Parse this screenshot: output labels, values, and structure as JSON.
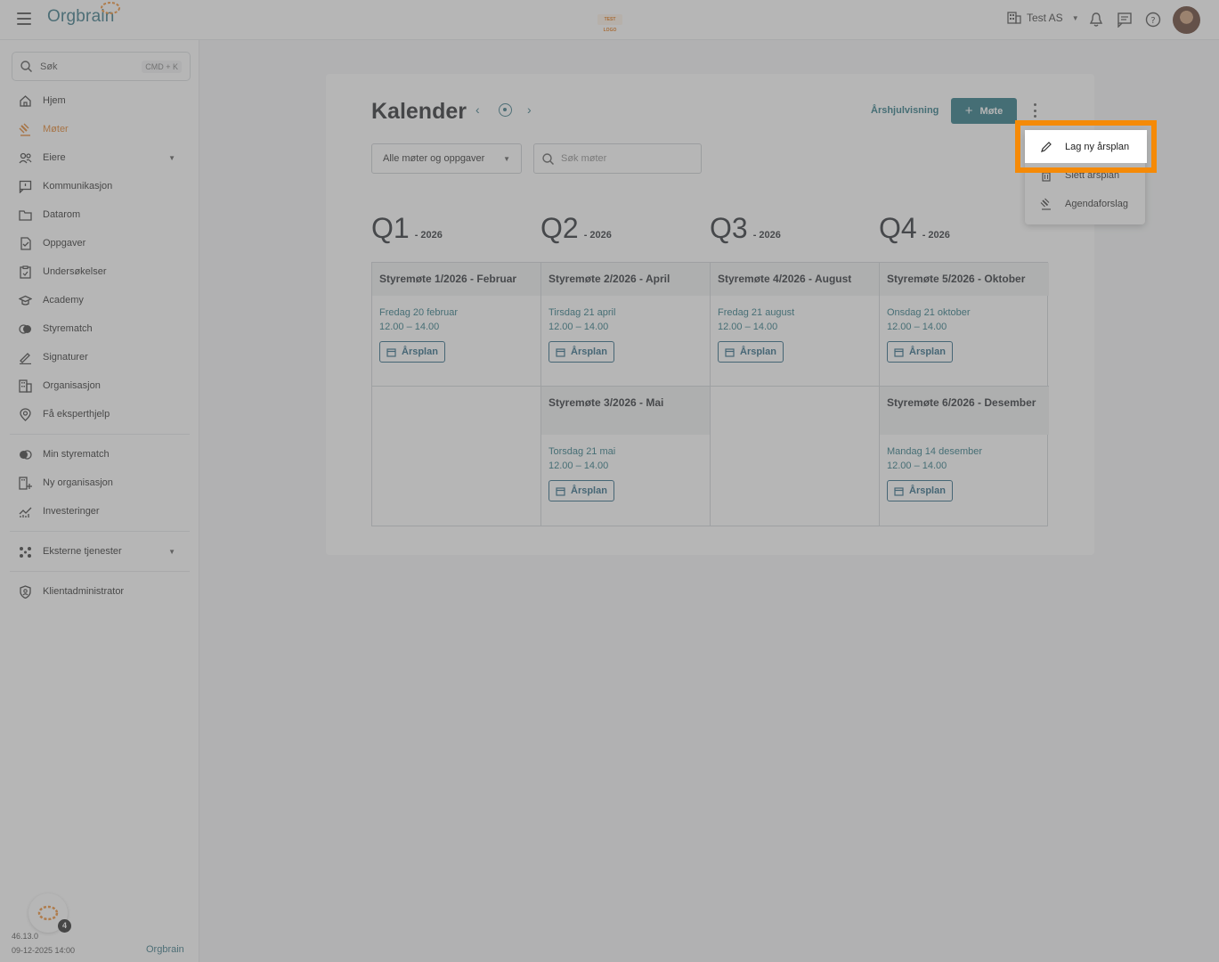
{
  "topbar": {
    "logo_text": "Orgbrain",
    "test_logo": "TEST LOGO",
    "org_name": "Test AS"
  },
  "sidebar": {
    "search_label": "Søk",
    "search_shortcut": "CMD + K",
    "items": [
      {
        "label": "Hjem",
        "icon": "home-icon"
      },
      {
        "label": "Møter",
        "icon": "gavel-icon",
        "active": true
      },
      {
        "label": "Eiere",
        "icon": "people-icon",
        "expandable": true
      },
      {
        "label": "Kommunikasjon",
        "icon": "message-icon"
      },
      {
        "label": "Datarom",
        "icon": "folder-icon"
      },
      {
        "label": "Oppgaver",
        "icon": "task-icon"
      },
      {
        "label": "Undersøkelser",
        "icon": "survey-icon"
      },
      {
        "label": "Academy",
        "icon": "academy-icon"
      },
      {
        "label": "Styrematch",
        "icon": "match-icon"
      },
      {
        "label": "Signaturer",
        "icon": "signature-icon"
      },
      {
        "label": "Organisasjon",
        "icon": "building-icon"
      },
      {
        "label": "Få eksperthjelp",
        "icon": "expert-icon"
      }
    ],
    "secondary_items": [
      {
        "label": "Min styrematch",
        "icon": "match-icon"
      },
      {
        "label": "Ny organisasjon",
        "icon": "new-building-icon"
      },
      {
        "label": "Investeringer",
        "icon": "chart-icon"
      }
    ],
    "external": {
      "label": "Eksterne tjenester",
      "icon": "apps-icon"
    },
    "client_admin": {
      "label": "Klientadministrator",
      "icon": "shield-icon"
    },
    "help_badge": "4",
    "version": "46.13.0",
    "datetime": "09-12-2025 14:00",
    "footer_logo": "Orgbrain"
  },
  "main": {
    "title": "Kalender",
    "yearwheel_link": "Årshjulvisning",
    "new_meeting_label": "Møte",
    "filter_value": "Alle møter og oppgaver",
    "search_placeholder": "Søk møter",
    "quarters": [
      {
        "q": "Q1",
        "year": "- 2026"
      },
      {
        "q": "Q2",
        "year": "- 2026"
      },
      {
        "q": "Q3",
        "year": "- 2026"
      },
      {
        "q": "Q4",
        "year": "- 2026"
      }
    ],
    "meetings": [
      {
        "title": "Styremøte 1/2026 - Februar",
        "date": "Fredag 20 februar",
        "time": "12.00 – 14.00",
        "tag": "Årsplan"
      },
      {
        "title": "Styremøte 2/2026 - April",
        "date": "Tirsdag 21 april",
        "time": "12.00 – 14.00",
        "tag": "Årsplan"
      },
      {
        "title": "Styremøte 4/2026 - August",
        "date": "Fredag 21 august",
        "time": "12.00 – 14.00",
        "tag": "Årsplan"
      },
      {
        "title": "Styremøte 5/2026 - Oktober",
        "date": "Onsdag 21 oktober",
        "time": "12.00 – 14.00",
        "tag": "Årsplan"
      },
      {
        "title": "Styremøte 3/2026 - Mai",
        "date": "Torsdag 21 mai",
        "time": "12.00 – 14.00",
        "tag": "Årsplan"
      },
      {
        "title": "Styremøte 6/2026 - Desember",
        "date": "Mandag 14 desember",
        "time": "12.00 – 14.00",
        "tag": "Årsplan"
      }
    ]
  },
  "menu": {
    "items": [
      {
        "label": "Lag ny årsplan",
        "icon": "pencil-icon"
      },
      {
        "label": "Slett årsplan",
        "icon": "trash-icon"
      },
      {
        "label": "Agendaforslag",
        "icon": "gavel-icon"
      }
    ]
  },
  "colors": {
    "accent": "#1d6e7c",
    "active_nav": "#e07a1f",
    "highlight": "#f58a07"
  }
}
